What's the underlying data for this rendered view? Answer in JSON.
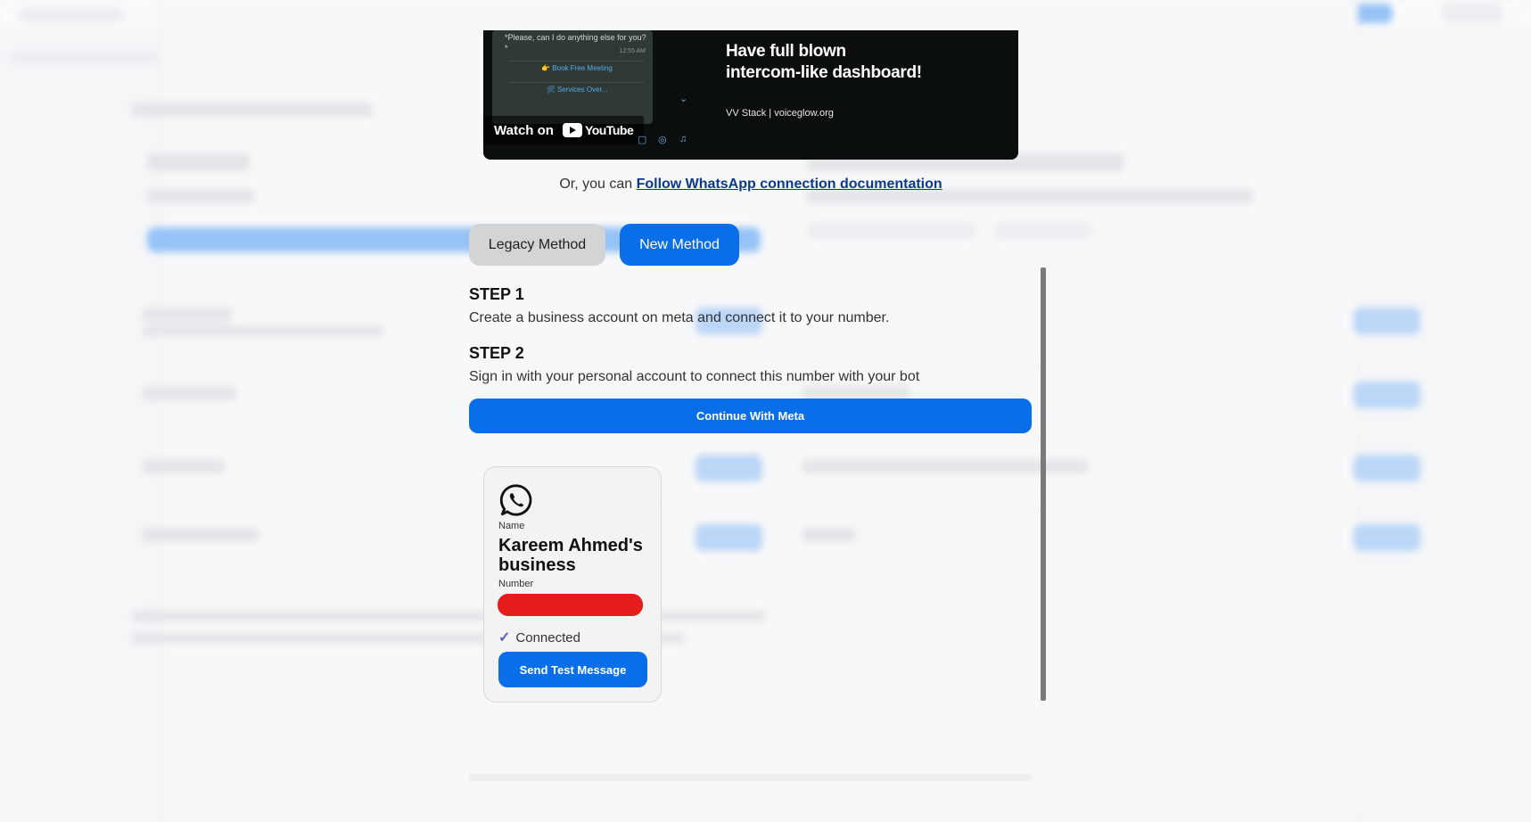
{
  "video": {
    "chat_text": "*Please, can I do anything else for you?*",
    "chat_time": "12:55 AM",
    "chat_options": [
      "👉 Book Free Meeting",
      "🛠 Services Over..."
    ],
    "watch_on": "Watch on",
    "youtube": "YouTube",
    "headline_line1": "Have full blown",
    "headline_line2": "intercom-like dashboard!",
    "subtitle": "VV Stack | voiceglow.org"
  },
  "doc": {
    "prefix": "Or, you can ",
    "link": "Follow WhatsApp connection documentation"
  },
  "methods": {
    "legacy": "Legacy Method",
    "new": "New Method"
  },
  "steps": [
    {
      "title": "STEP 1",
      "desc": "Create a business account on meta and connect it to your number."
    },
    {
      "title": "STEP 2",
      "desc": "Sign in with your personal account to connect this number with your bot"
    }
  ],
  "continue_label": "Continue With Meta",
  "card": {
    "name_label": "Name",
    "name": "Kareem Ahmed's business",
    "number_label": "Number",
    "status": "Connected",
    "test_button": "Send Test Message"
  },
  "icons": {
    "whatsapp": "whatsapp-icon",
    "check": "check-icon",
    "youtube": "youtube-play-icon"
  },
  "colors": {
    "primary": "#0a6ee8",
    "redaction": "#e61c1c"
  }
}
